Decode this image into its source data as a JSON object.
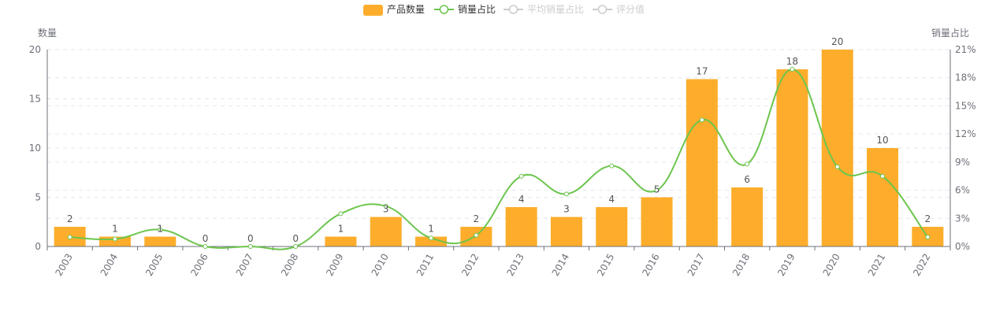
{
  "legend": {
    "items": [
      {
        "name": "产品数量",
        "kind": "bar",
        "active": true
      },
      {
        "name": "销量占比",
        "kind": "line",
        "active": true
      },
      {
        "name": "平均销量占比",
        "kind": "line",
        "active": false
      },
      {
        "name": "评分值",
        "kind": "line",
        "active": false
      }
    ]
  },
  "colors": {
    "bar": "#fdad2b",
    "line": "#6cc54d",
    "inactive": "#cccccc",
    "axis_text": "#6e7079",
    "grid": "#e0e6f1",
    "label": "#555555"
  },
  "chart_data": {
    "type": "bar",
    "categories": [
      "2003",
      "2004",
      "2005",
      "2006",
      "2007",
      "2008",
      "2009",
      "2010",
      "2011",
      "2012",
      "2013",
      "2014",
      "2015",
      "2016",
      "2017",
      "2018",
      "2019",
      "2020",
      "2021",
      "2022"
    ],
    "series": [
      {
        "name": "产品数量",
        "type": "bar",
        "axis": "left",
        "values": [
          2,
          1,
          1,
          0,
          0,
          0,
          1,
          3,
          1,
          2,
          4,
          3,
          4,
          5,
          17,
          6,
          18,
          20,
          10,
          2
        ]
      },
      {
        "name": "销量占比",
        "type": "line",
        "axis": "right",
        "values": [
          1.0,
          0.8,
          1.8,
          0,
          0,
          0,
          3.5,
          4.3,
          0.9,
          1.2,
          7.5,
          5.6,
          8.6,
          6.0,
          13.5,
          8.8,
          18.9,
          8.5,
          7.5,
          1.0
        ]
      }
    ],
    "y_left": {
      "label": "数量",
      "min": 0,
      "max": 20,
      "ticks": [
        0,
        5,
        10,
        15,
        20
      ]
    },
    "y_right": {
      "label": "销量占比",
      "min": 0,
      "max": 21,
      "ticks": [
        "0%",
        "3%",
        "6%",
        "9%",
        "12%",
        "15%",
        "18%",
        "21%"
      ]
    },
    "grid": true,
    "legend_position": "top-center"
  }
}
